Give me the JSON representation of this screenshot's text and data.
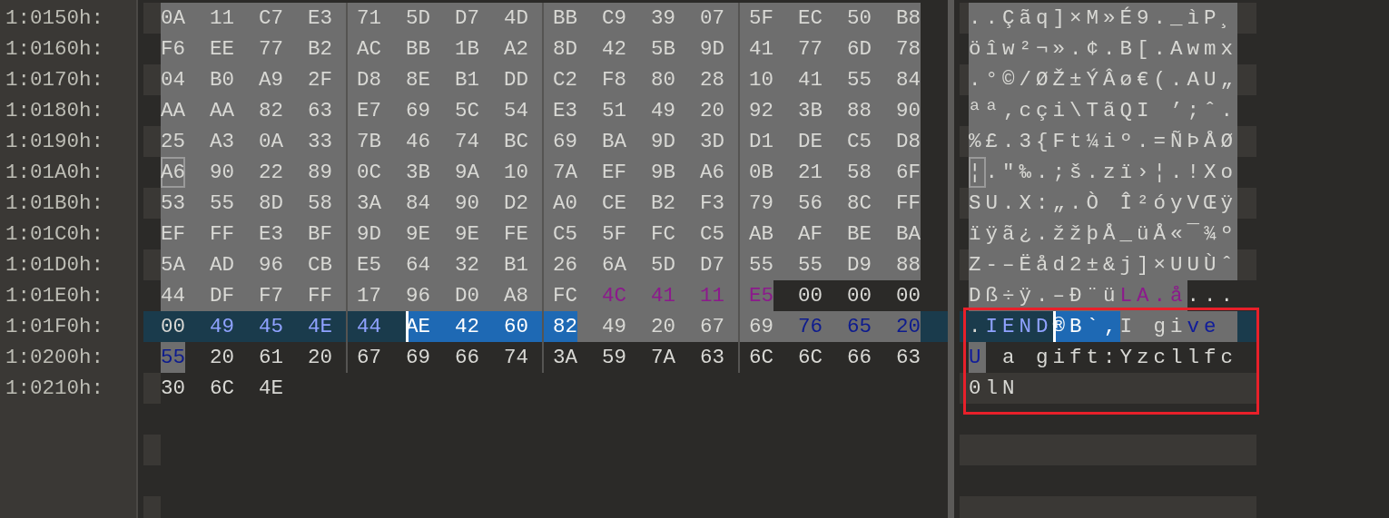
{
  "rows": [
    {
      "address": "1:0150h:",
      "current": false,
      "framed": false,
      "runs": [
        {
          "kind": "normal",
          "marked": true,
          "boxed": false,
          "cursor": false,
          "hex": [
            "0A",
            "11",
            "C7",
            "E3",
            "71",
            "5D",
            "D7",
            "4D",
            "BB",
            "C9",
            "39",
            "07",
            "5F",
            "EC",
            "50",
            "B8"
          ],
          "text": "..Çãq]×M»É9._ìP¸"
        }
      ]
    },
    {
      "address": "1:0160h:",
      "current": false,
      "framed": false,
      "runs": [
        {
          "kind": "normal",
          "marked": true,
          "boxed": false,
          "cursor": false,
          "hex": [
            "F6",
            "EE",
            "77",
            "B2",
            "AC",
            "BB",
            "1B",
            "A2",
            "8D",
            "42",
            "5B",
            "9D",
            "41",
            "77",
            "6D",
            "78"
          ],
          "text": "öîw²¬».¢.B[.Awmx"
        }
      ]
    },
    {
      "address": "1:0170h:",
      "current": false,
      "framed": false,
      "runs": [
        {
          "kind": "normal",
          "marked": true,
          "boxed": false,
          "cursor": false,
          "hex": [
            "04",
            "B0",
            "A9",
            "2F",
            "D8",
            "8E",
            "B1",
            "DD",
            "C2",
            "F8",
            "80",
            "28",
            "10",
            "41",
            "55",
            "84"
          ],
          "text": ".°©/ØŽ±ÝÂø€(.AU„"
        }
      ]
    },
    {
      "address": "1:0180h:",
      "current": false,
      "framed": false,
      "runs": [
        {
          "kind": "normal",
          "marked": true,
          "boxed": false,
          "cursor": false,
          "hex": [
            "AA",
            "AA",
            "82",
            "63",
            "E7",
            "69",
            "5C",
            "54",
            "E3",
            "51",
            "49",
            "20",
            "92",
            "3B",
            "88",
            "90"
          ],
          "text": "ªª‚cçi\\TãQI ’;ˆ."
        }
      ]
    },
    {
      "address": "1:0190h:",
      "current": false,
      "framed": false,
      "runs": [
        {
          "kind": "normal",
          "marked": true,
          "boxed": false,
          "cursor": false,
          "hex": [
            "25",
            "A3",
            "0A",
            "33",
            "7B",
            "46",
            "74",
            "BC",
            "69",
            "BA",
            "9D",
            "3D",
            "D1",
            "DE",
            "C5",
            "D8"
          ],
          "text": "%£.3{Ft¼iº.=ÑÞÅØ"
        }
      ]
    },
    {
      "address": "1:01A0h:",
      "current": false,
      "framed": false,
      "runs": [
        {
          "kind": "normal",
          "marked": true,
          "boxed": true,
          "cursor": false,
          "hex": [
            "A6"
          ],
          "text": "¦"
        },
        {
          "kind": "normal",
          "marked": true,
          "boxed": false,
          "cursor": false,
          "hex": [
            "90",
            "22",
            "89",
            "0C",
            "3B",
            "9A",
            "10",
            "7A",
            "EF",
            "9B",
            "A6",
            "0B",
            "21",
            "58",
            "6F"
          ],
          "text": ".\"‰.;š.zï›¦.!Xo"
        }
      ]
    },
    {
      "address": "1:01B0h:",
      "current": false,
      "framed": false,
      "runs": [
        {
          "kind": "normal",
          "marked": true,
          "boxed": false,
          "cursor": false,
          "hex": [
            "53",
            "55",
            "8D",
            "58",
            "3A",
            "84",
            "90",
            "D2",
            "A0",
            "CE",
            "B2",
            "F3",
            "79",
            "56",
            "8C",
            "FF"
          ],
          "text": "SU.X:„.Ò Î²óyVŒÿ"
        }
      ]
    },
    {
      "address": "1:01C0h:",
      "current": false,
      "framed": false,
      "runs": [
        {
          "kind": "normal",
          "marked": true,
          "boxed": false,
          "cursor": false,
          "hex": [
            "EF",
            "FF",
            "E3",
            "BF",
            "9D",
            "9E",
            "9E",
            "FE",
            "C5",
            "5F",
            "FC",
            "C5",
            "AB",
            "AF",
            "BE",
            "BA"
          ],
          "text": "ïÿã¿.žžþÅ_üÅ«¯¾º"
        }
      ]
    },
    {
      "address": "1:01D0h:",
      "current": false,
      "framed": false,
      "runs": [
        {
          "kind": "normal",
          "marked": true,
          "boxed": false,
          "cursor": false,
          "hex": [
            "5A",
            "AD",
            "96",
            "CB",
            "E5",
            "64",
            "32",
            "B1",
            "26",
            "6A",
            "5D",
            "D7",
            "55",
            "55",
            "D9",
            "88"
          ],
          "text": "Z-–Ëåd2±&j]×UUÙˆ"
        }
      ]
    },
    {
      "address": "1:01E0h:",
      "current": false,
      "framed": false,
      "runs": [
        {
          "kind": "normal",
          "marked": true,
          "boxed": false,
          "cursor": false,
          "hex": [
            "44",
            "DF",
            "F7",
            "FF",
            "17",
            "96",
            "D0",
            "A8",
            "FC"
          ],
          "text": "Dß÷ÿ.–Ð¨ü"
        },
        {
          "kind": "found",
          "marked": true,
          "boxed": false,
          "cursor": false,
          "hex": [
            "4C",
            "41",
            "11",
            "E5"
          ],
          "text": "LA.å"
        },
        {
          "kind": "normal",
          "marked": false,
          "boxed": false,
          "cursor": false,
          "hex": [
            "00",
            "00",
            "00"
          ],
          "text": "..."
        }
      ]
    },
    {
      "address": "1:01F0h:",
      "current": true,
      "framed": true,
      "runs": [
        {
          "kind": "normal",
          "marked": false,
          "boxed": false,
          "cursor": false,
          "hex": [
            "00"
          ],
          "text": "."
        },
        {
          "kind": "keyword",
          "marked": false,
          "boxed": false,
          "cursor": false,
          "hex": [
            "49",
            "45",
            "4E",
            "44"
          ],
          "text": "IEND"
        },
        {
          "kind": "selected",
          "marked": false,
          "boxed": false,
          "cursor": true,
          "hex": [
            "AE",
            "42",
            "60",
            "82"
          ],
          "text": "®B`‚"
        },
        {
          "kind": "normal",
          "marked": true,
          "boxed": false,
          "cursor": false,
          "hex": [
            "49",
            "20",
            "67",
            "69"
          ],
          "text": "I gi"
        },
        {
          "kind": "keyword",
          "marked": true,
          "boxed": false,
          "cursor": false,
          "hex": [
            "76",
            "65",
            "20"
          ],
          "text": "ve "
        }
      ]
    },
    {
      "address": "1:0200h:",
      "current": false,
      "framed": true,
      "runs": [
        {
          "kind": "keyword",
          "marked": true,
          "boxed": false,
          "cursor": false,
          "hex": [
            "55"
          ],
          "text": "U"
        },
        {
          "kind": "normal",
          "marked": false,
          "boxed": false,
          "cursor": false,
          "hex": [
            "20",
            "61",
            "20",
            "67",
            "69",
            "66",
            "74",
            "3A",
            "59",
            "7A",
            "63",
            "6C",
            "6C",
            "66",
            "63"
          ],
          "text": " a gift:Yzcllfc"
        }
      ]
    },
    {
      "address": "1:0210h:",
      "current": false,
      "framed": true,
      "runs": [
        {
          "kind": "normal",
          "marked": false,
          "boxed": false,
          "cursor": false,
          "hex": [
            "30",
            "6C",
            "4E"
          ],
          "text": "0lN"
        }
      ]
    }
  ]
}
